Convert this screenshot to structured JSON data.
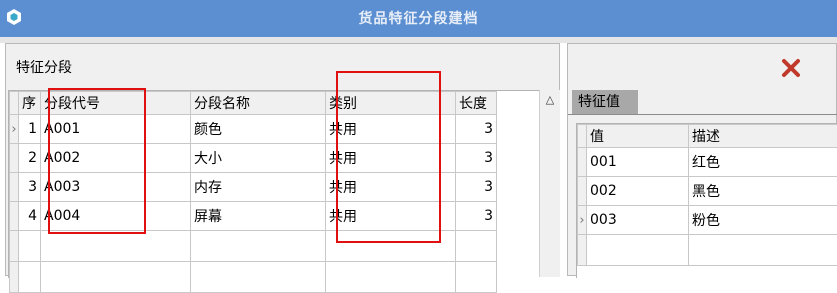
{
  "window": {
    "title": "货品特征分段建档",
    "icon": "app-hexagon-icon",
    "title_bar_color": "#5b8fd1"
  },
  "left_panel": {
    "title": "特征分段",
    "columns": [
      "序",
      "分段代号",
      "分段名称",
      "类别",
      "长度"
    ],
    "rows": [
      {
        "indicator": "›",
        "seq": "1",
        "code": "A001",
        "name": "颜色",
        "category": "共用",
        "length": "3"
      },
      {
        "indicator": "",
        "seq": "2",
        "code": "A002",
        "name": "大小",
        "category": "共用",
        "length": "3"
      },
      {
        "indicator": "",
        "seq": "3",
        "code": "A003",
        "name": "内存",
        "category": "共用",
        "length": "3"
      },
      {
        "indicator": "",
        "seq": "4",
        "code": "A004",
        "name": "屏幕",
        "category": "共用",
        "length": "3"
      }
    ],
    "scroll_up_icon": "chevron-up-icon"
  },
  "right_panel": {
    "close_icon": "close-icon",
    "tab_label": "特征值",
    "columns": [
      "值",
      "描述"
    ],
    "rows": [
      {
        "indicator": "",
        "value": "001",
        "desc": "红色"
      },
      {
        "indicator": "",
        "value": "002",
        "desc": "黑色"
      },
      {
        "indicator": "›",
        "value": "003",
        "desc": "粉色"
      }
    ]
  },
  "colors": {
    "highlight": "#e01010",
    "close": "#c0392b"
  }
}
